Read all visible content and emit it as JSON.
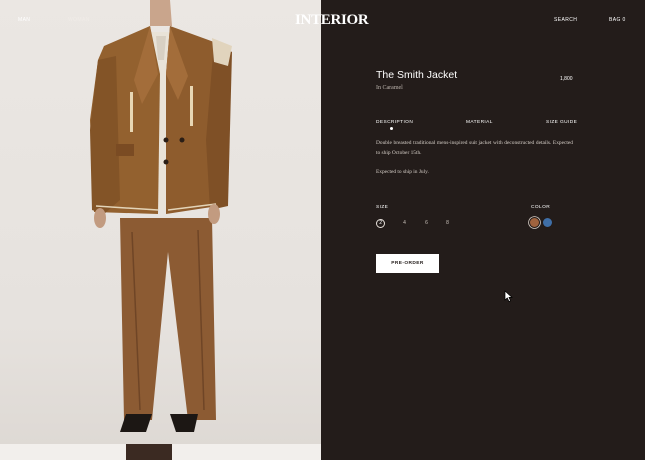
{
  "nav": {
    "left": [
      "MAN",
      "WOMAN"
    ],
    "logo": "INTERIOR",
    "right": [
      "SEARCH",
      "BAG 0"
    ]
  },
  "product": {
    "title": "The Smith Jacket",
    "color_line": "In Caramel",
    "price": "1,800"
  },
  "tabs": [
    {
      "label": "DESCRIPTION",
      "active": true
    },
    {
      "label": "MATERIAL",
      "active": false
    },
    {
      "label": "SIZE GUIDE",
      "active": false
    }
  ],
  "description": {
    "paragraph": "Double breasted traditional mens-inspired suit jacket with deconstructed details. Expected to ship October 15th.",
    "ship_note": "Expected to ship in July."
  },
  "size": {
    "label": "SIZE",
    "options": [
      "2",
      "4",
      "6",
      "8"
    ],
    "selected": "2"
  },
  "color": {
    "label": "COLOR",
    "swatches": [
      {
        "name": "caramel",
        "hex": "#a0633e",
        "selected": true
      },
      {
        "name": "blue",
        "hex": "#3f6fa8",
        "selected": false
      }
    ]
  },
  "cta": {
    "label": "PRE-ORDER"
  },
  "colors": {
    "dark_panel": "#231c1a",
    "photo_bg": "#e7e3df",
    "suit": "#8a5a33"
  }
}
